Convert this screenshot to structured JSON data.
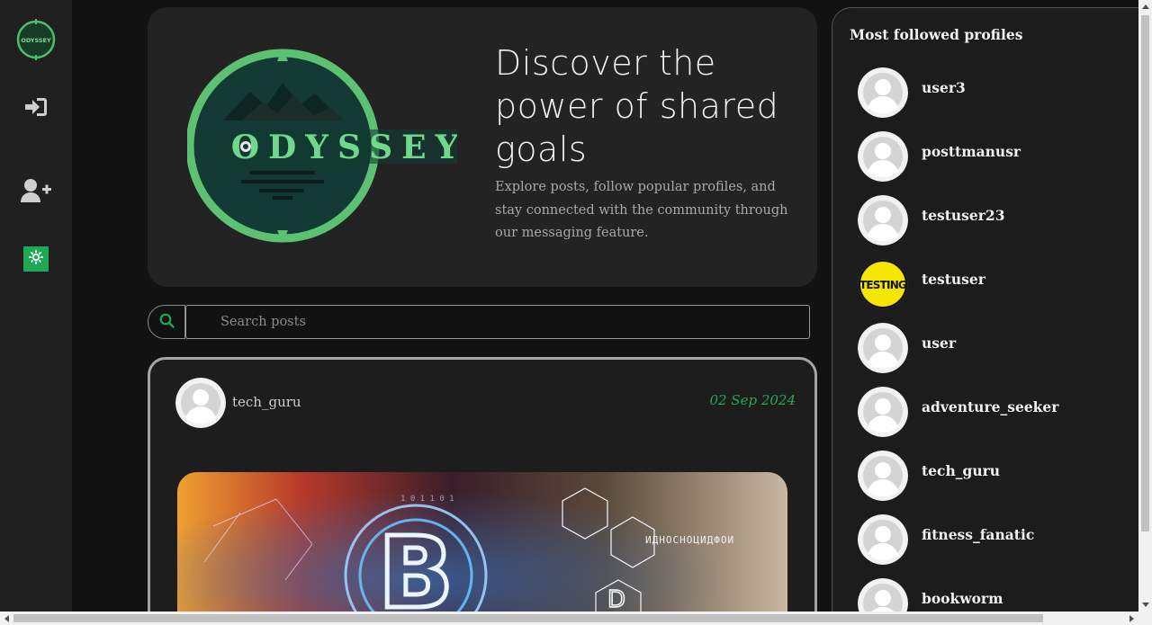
{
  "app": {
    "logo_text": "ODYSSEY"
  },
  "sidenav": {
    "items": [
      {
        "name": "login",
        "icon": "sign-in-icon"
      },
      {
        "name": "register",
        "icon": "user-plus-icon"
      },
      {
        "name": "theme",
        "icon": "sun-icon"
      }
    ]
  },
  "hero": {
    "logo_text": "ODYSSEY",
    "title": "Discover the power of shared goals",
    "description": "Explore posts, follow popular profiles, and stay connected with the community through our messaging feature."
  },
  "search": {
    "placeholder": "Search posts",
    "value": "",
    "icon": "search-icon"
  },
  "post": {
    "username": "tech_guru",
    "date": "02 Sep 2024",
    "image_text": "ИДНОСНОЦИДФОИ"
  },
  "sidebar": {
    "title": "Most followed profiles",
    "profiles": [
      {
        "name": "user3",
        "avatar": "default"
      },
      {
        "name": "posttmanusr",
        "avatar": "default"
      },
      {
        "name": "testuser23",
        "avatar": "default"
      },
      {
        "name": "testuser",
        "avatar": "testing",
        "avatar_text": "TESTING"
      },
      {
        "name": "user",
        "avatar": "default"
      },
      {
        "name": "adventure_seeker",
        "avatar": "default"
      },
      {
        "name": "tech_guru",
        "avatar": "default"
      },
      {
        "name": "fitness_fanatic",
        "avatar": "default"
      },
      {
        "name": "bookworm",
        "avatar": "default"
      }
    ]
  },
  "colors": {
    "accent": "#1fa855",
    "logo_green": "#4cbf6a",
    "background": "#121212",
    "panel": "#232323"
  }
}
